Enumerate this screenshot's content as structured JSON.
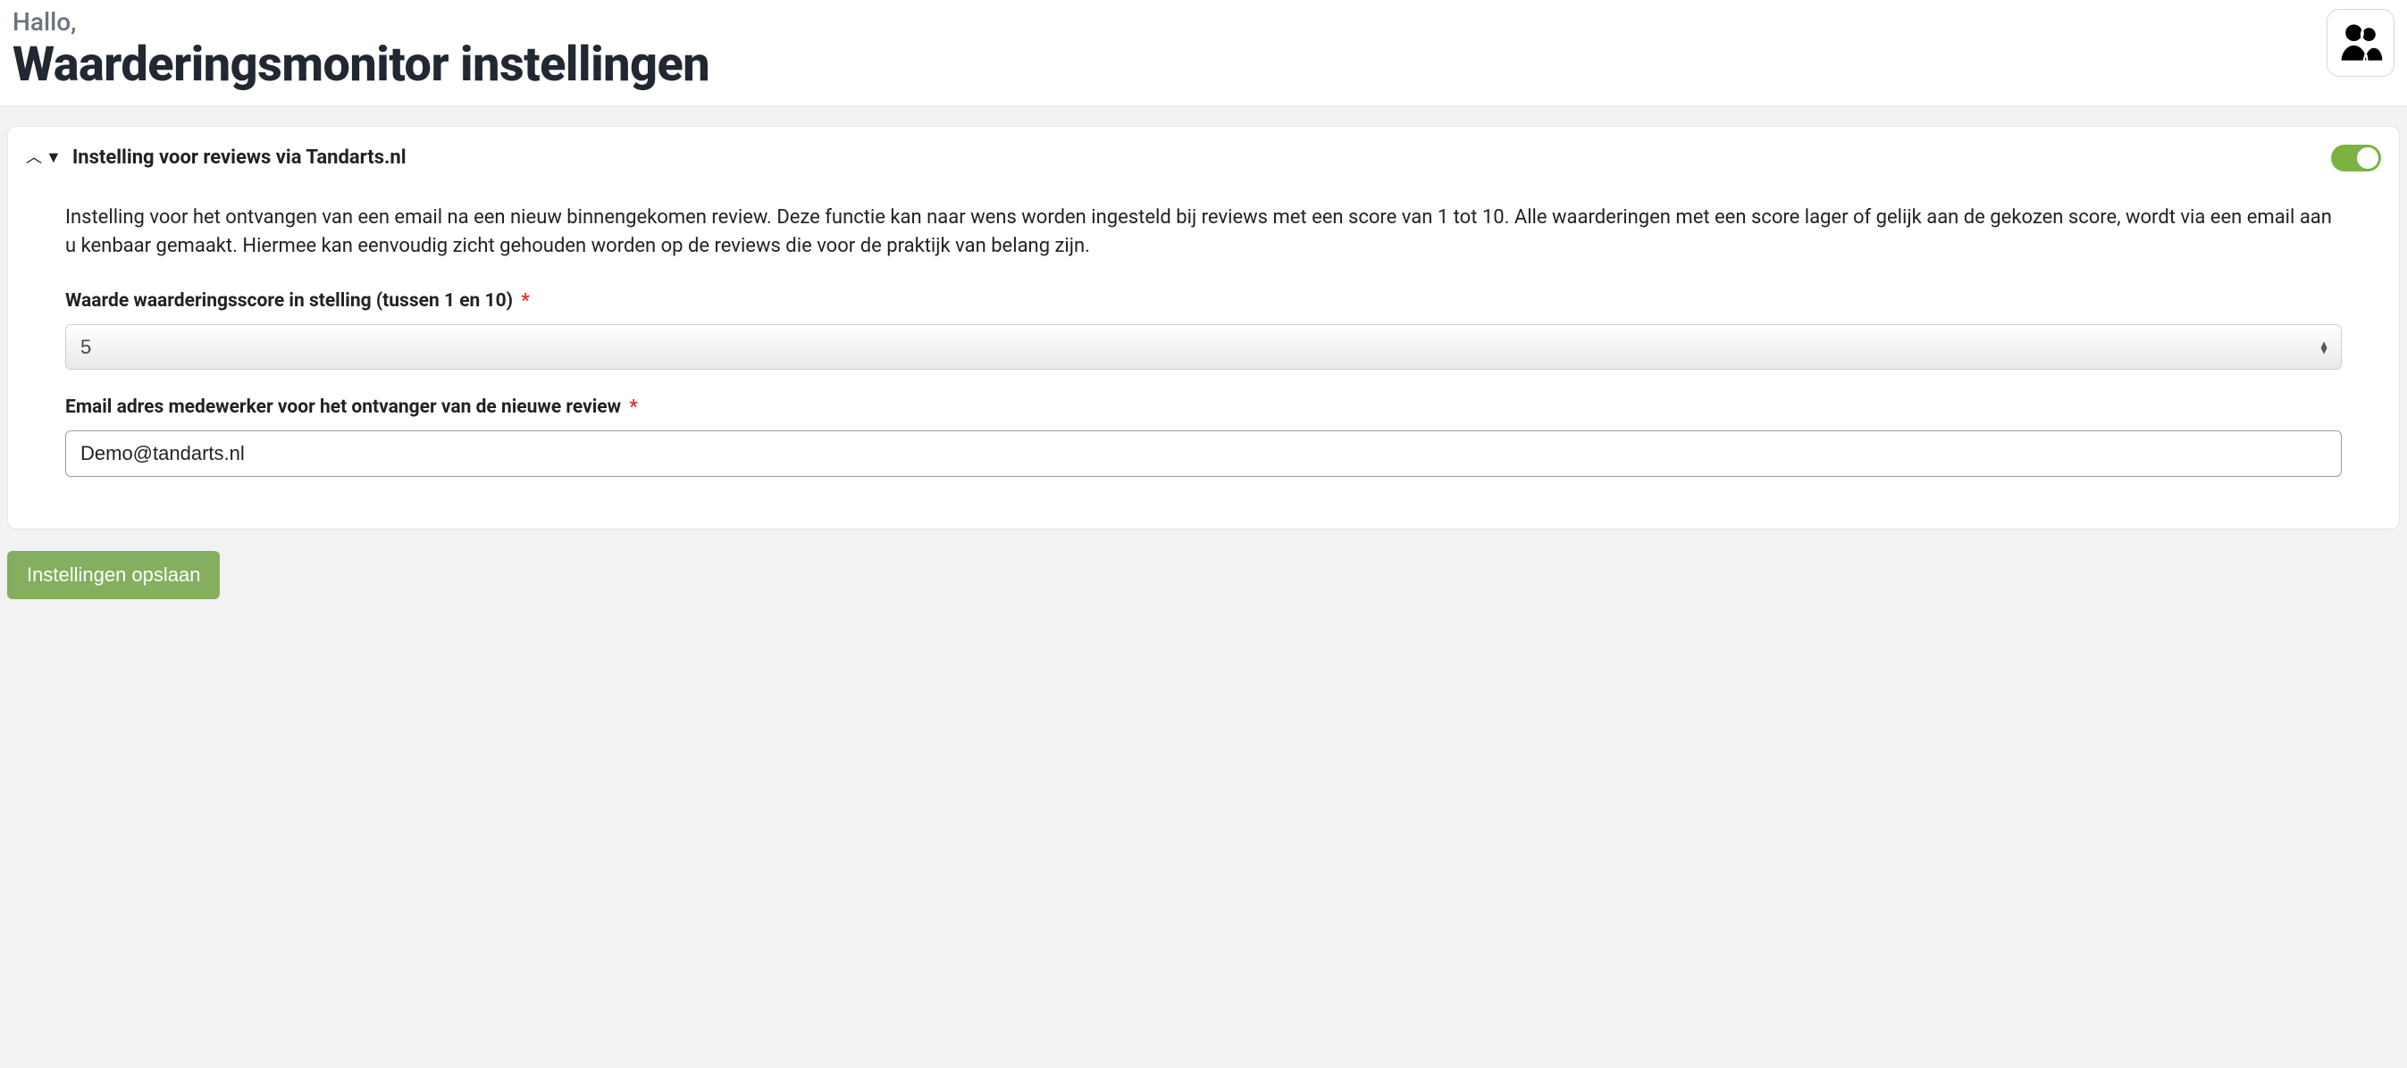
{
  "header": {
    "greeting": "Hallo,",
    "page_title": "Waarderingsmonitor instellingen"
  },
  "section": {
    "title": "Instelling voor reviews via Tandarts.nl",
    "enabled": true,
    "description": "Instelling voor het ontvangen van een email na een nieuw binnengekomen review. Deze functie kan naar wens worden ingesteld bij reviews met een score van 1 tot 10. Alle waarderingen met een score lager of gelijk aan de gekozen score, wordt via een email aan u kenbaar gemaakt. Hiermee kan eenvoudig zicht gehouden worden op de reviews die voor de praktijk van belang zijn.",
    "score_label": "Waarde waarderingsscore in stelling (tussen 1 en 10)",
    "score_value": "5",
    "email_label": "Email adres medewerker voor het ontvanger van de nieuwe review",
    "email_value": "Demo@tandarts.nl"
  },
  "buttons": {
    "save": "Instellingen opslaan"
  }
}
